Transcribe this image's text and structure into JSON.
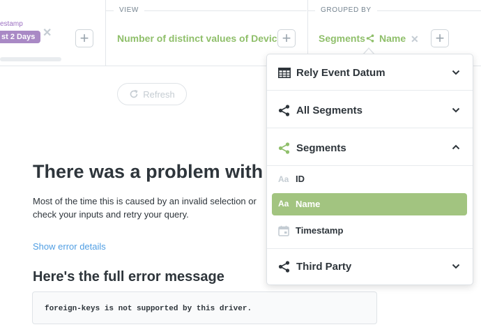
{
  "querybar": {
    "filter": {
      "label_partial": "estamp",
      "pill_partial": "st 2 Days"
    },
    "view": {
      "section_label": "VIEW",
      "metric": "Number of distinct values of Device"
    },
    "grouped_by": {
      "section_label": "GROUPED BY",
      "table": "Segments",
      "field": "Name"
    }
  },
  "main": {
    "refresh_label": "Refresh",
    "error_title_partial": "There was a problem with y",
    "error_body_partial": "Most of the time this is caused by an invalid selection or check your inputs and retry your query.",
    "show_details_link": "Show error details",
    "full_error_heading": "Here's the full error message",
    "error_message": "foreign-keys is not supported by this driver."
  },
  "popover": {
    "sections": [
      {
        "title": "Rely Event Datum",
        "icon": "table-icon",
        "expanded": false
      },
      {
        "title": "All Segments",
        "icon": "share-icon",
        "expanded": false
      },
      {
        "title": "Segments",
        "icon": "share-icon",
        "expanded": true
      },
      {
        "title": "Third Party",
        "icon": "share-icon",
        "expanded": false
      }
    ],
    "fields": [
      {
        "label": "ID",
        "icon": "text-aa-icon",
        "selected": false
      },
      {
        "label": "Name",
        "icon": "text-aa-icon",
        "selected": true
      },
      {
        "label": "Timestamp",
        "icon": "calendar-icon",
        "selected": false
      }
    ],
    "aa_glyph": "Aa"
  },
  "colors": {
    "accent_green": "#8fbf6a",
    "selected_bg": "#a2c480",
    "filter_purple": "#a989c5",
    "link_blue": "#509ee3"
  }
}
